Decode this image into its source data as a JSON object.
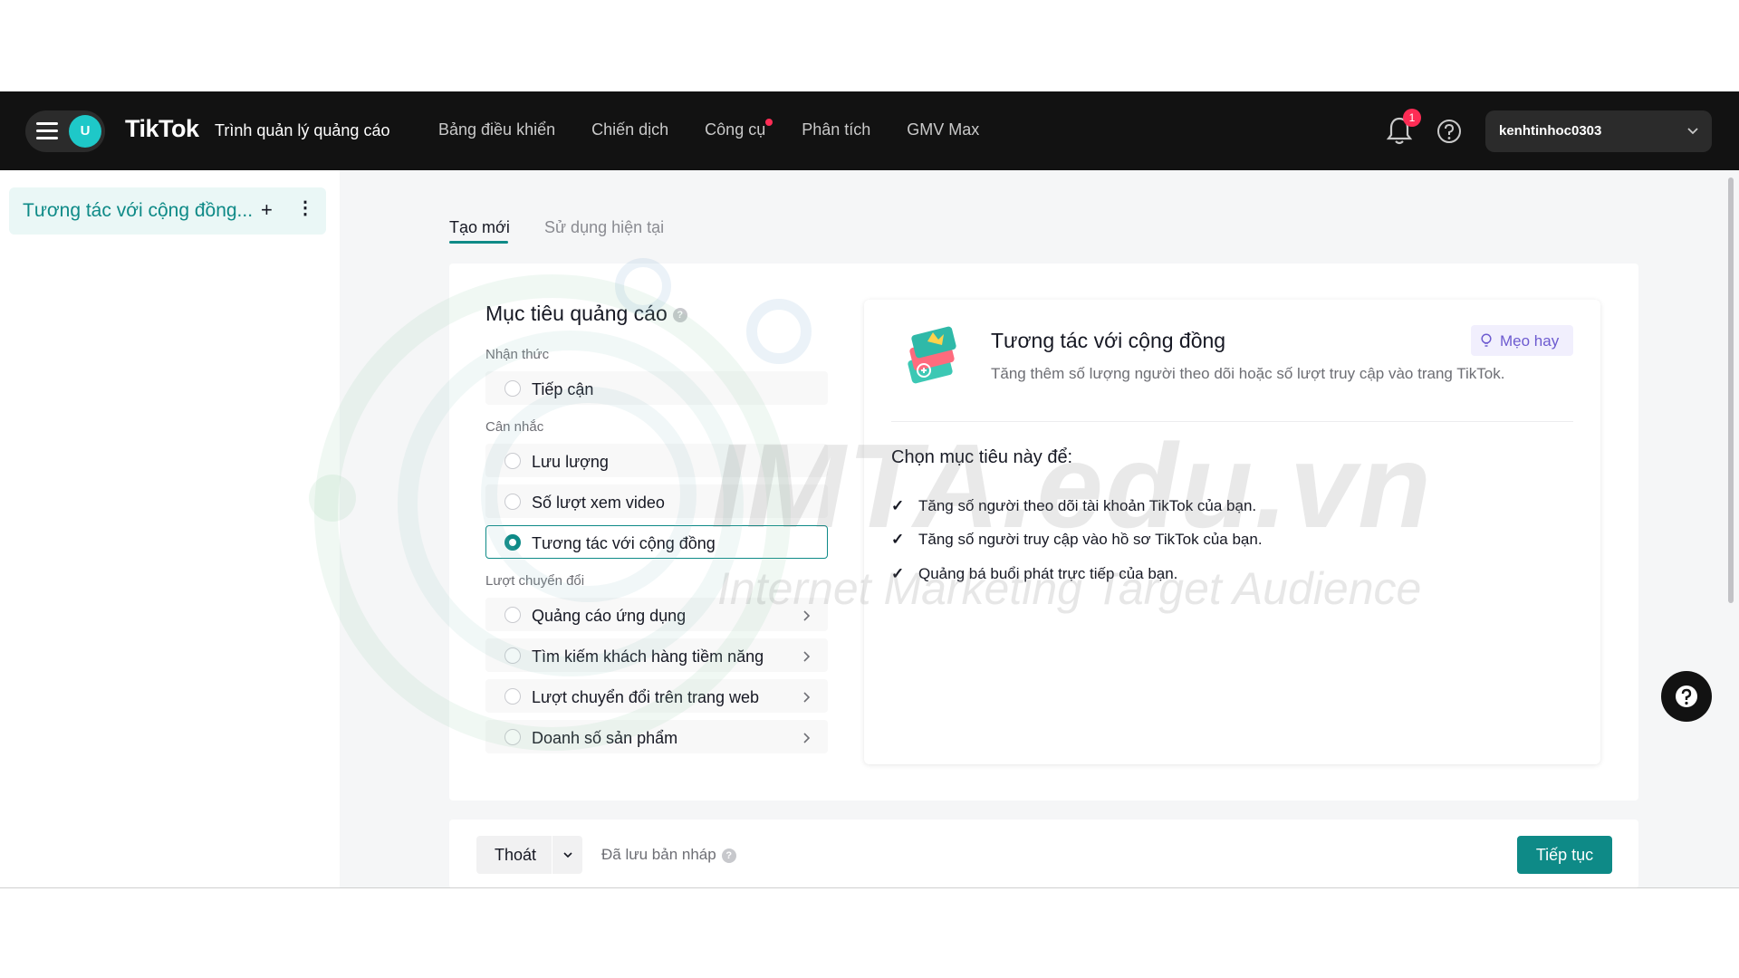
{
  "header": {
    "avatar_initial": "U",
    "logo": "TikTok",
    "logo_subtitle": "Trình quản lý quảng cáo",
    "nav": [
      {
        "label": "Bảng điều khiển",
        "has_dot": false
      },
      {
        "label": "Chiến dịch",
        "has_dot": false
      },
      {
        "label": "Công cụ",
        "has_dot": true
      },
      {
        "label": "Phân tích",
        "has_dot": false
      },
      {
        "label": "GMV Max",
        "has_dot": false
      }
    ],
    "notification_count": "1",
    "account_name": "kenhtinhoc0303"
  },
  "sidebar": {
    "campaign_name": "Tương tác với cộng đồng...",
    "add_icon": "+",
    "more_icon": "⋮"
  },
  "watermark": {
    "title": "IMTA.edu.vn",
    "subtitle": "Internet Marketing Target Audience"
  },
  "tabs": [
    {
      "label": "Tạo mới",
      "active": true
    },
    {
      "label": "Sử dụng hiện tại",
      "active": false
    }
  ],
  "objective": {
    "title": "Mục tiêu quảng cáo",
    "help_icon": "?",
    "groups": [
      {
        "label": "Nhận thức",
        "options": [
          {
            "label": "Tiếp cận",
            "selected": false,
            "has_chevron": false
          }
        ]
      },
      {
        "label": "Cân nhắc",
        "options": [
          {
            "label": "Lưu lượng",
            "selected": false,
            "has_chevron": false
          },
          {
            "label": "Số lượt xem video",
            "selected": false,
            "has_chevron": false
          },
          {
            "label": "Tương tác với cộng đồng",
            "selected": true,
            "has_chevron": false
          }
        ]
      },
      {
        "label": "Lượt chuyển đổi",
        "options": [
          {
            "label": "Quảng cáo ứng dụng",
            "selected": false,
            "has_chevron": true
          },
          {
            "label": "Tìm kiếm khách hàng tiềm năng",
            "selected": false,
            "has_chevron": true
          },
          {
            "label": "Lượt chuyển đổi trên trang web",
            "selected": false,
            "has_chevron": true
          },
          {
            "label": "Doanh số sản phẩm",
            "selected": false,
            "has_chevron": true
          }
        ]
      }
    ]
  },
  "detail": {
    "title": "Tương tác với cộng đồng",
    "description": "Tăng thêm số lượng người theo dõi hoặc số lượt truy cập vào trang TikTok.",
    "tip_label": "Mẹo hay",
    "choose_heading": "Chọn mục tiêu này để:",
    "benefits": [
      "Tăng số người theo dõi tài khoản TikTok của bạn.",
      "Tăng số người truy cập vào hồ sơ TikTok của bạn.",
      "Quảng bá buổi phát trực tiếp của bạn."
    ]
  },
  "footer": {
    "exit_label": "Thoát",
    "draft_label": "Đã lưu bản nháp",
    "draft_help": "?",
    "continue_label": "Tiếp tục"
  },
  "colors": {
    "accent": "#0e8a87",
    "nav_bg": "#121212",
    "tip_bg": "#f1effd",
    "tip_text": "#6d5bd0",
    "badge": "#fe2c55"
  }
}
